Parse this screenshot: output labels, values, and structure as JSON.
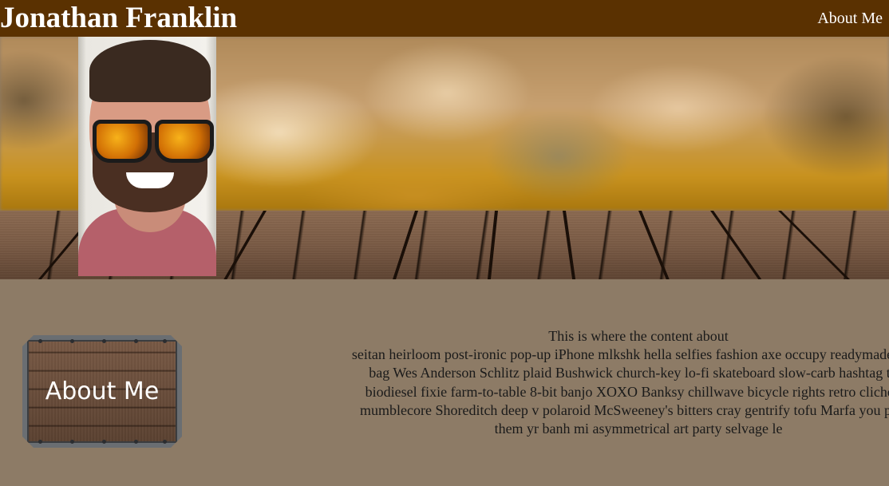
{
  "header": {
    "title": "Jonathan Franklin",
    "nav": [
      {
        "label": "About Me"
      }
    ]
  },
  "hero": {
    "profile_photo_alt": "Jonathan Franklin profile photo"
  },
  "about": {
    "sign_label": "About Me",
    "text_lines": [
      "This is where the content about",
      "seitan heirloom post-ironic pop-up iPhone mlkshk hella selfies fashion axe occupy readymade put a",
      "bag Wes Anderson Schlitz plaid Bushwick church-key lo-fi skateboard slow-carb hashtag trus",
      "biodiesel fixie farm-to-table 8-bit banjo XOXO Banksy chillwave bicycle rights retro cliche tat",
      "mumblecore Shoreditch deep v polaroid McSweeney's bitters cray gentrify tofu Marfa you proba",
      "them yr banh mi asymmetrical art party selvage le"
    ]
  },
  "colors": {
    "header_bg": "#5a3101",
    "page_bg": "#8d7b66",
    "header_text": "#ffffff",
    "body_text": "#1a1a1a"
  },
  "icons": {
    "profile": "profile-photo",
    "sign": "wooden-sign-icon"
  }
}
